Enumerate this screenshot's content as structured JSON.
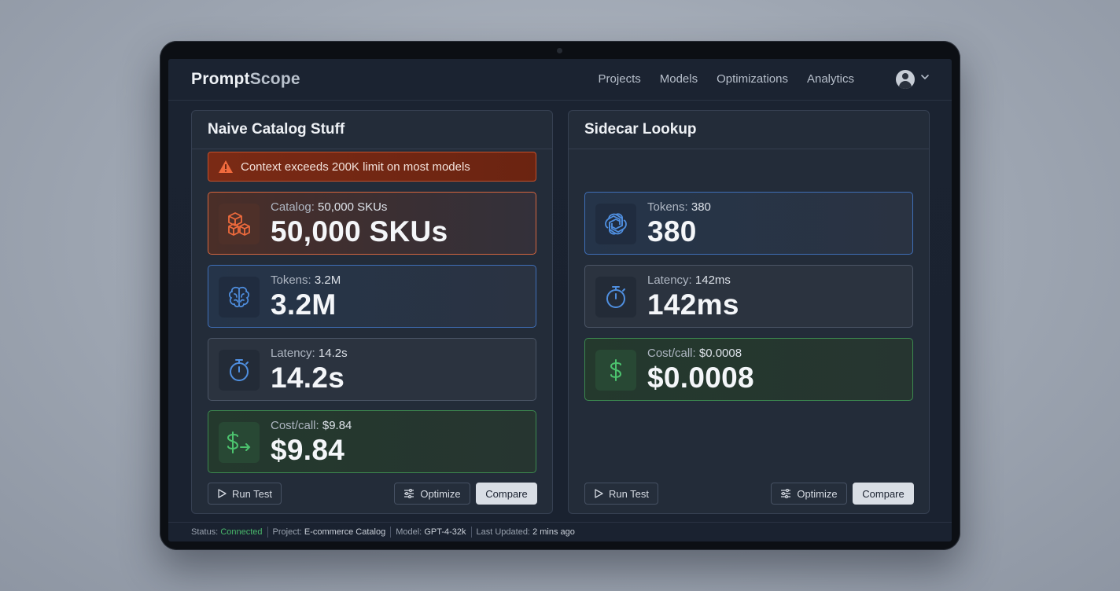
{
  "app": {
    "logo_part1": "Prompt",
    "logo_part2": "Scope"
  },
  "nav": {
    "items": [
      "Projects",
      "Models",
      "Optimizations",
      "Analytics"
    ],
    "avatar_icon": "user-avatar-icon",
    "menu_icon": "chevron-down-icon"
  },
  "left_panel": {
    "title": "Naive Catalog Stuff",
    "alert": {
      "icon": "warning-icon",
      "text": "Context exceeds 200K limit on most models"
    },
    "cards": [
      {
        "icon": "boxes-icon",
        "label": "Catalog:",
        "label_value": "50,000 SKUs",
        "value": "50,000 SKUs"
      },
      {
        "icon": "brain-icon",
        "label": "Tokens:",
        "label_value": "3.2M",
        "value": "3.2M"
      },
      {
        "icon": "stopwatch-icon",
        "label": "Latency:",
        "label_value": "14.2s",
        "value": "14.2s"
      },
      {
        "icon": "dollar-arrow-icon",
        "label": "Cost/call:",
        "label_value": "$9.84",
        "value": "$9.84"
      }
    ],
    "buttons": {
      "run": "Run Test",
      "optimize": "Optimize",
      "compare": "Compare"
    }
  },
  "right_panel": {
    "title": "Sidecar Lookup",
    "cards": [
      {
        "icon": "openai-icon",
        "label": "Tokens:",
        "label_value": "380",
        "value": "380"
      },
      {
        "icon": "stopwatch-icon",
        "label": "Latency:",
        "label_value": "142ms",
        "value": "142ms"
      },
      {
        "icon": "dollar-icon",
        "label": "Cost/call:",
        "label_value": "$0.0008",
        "value": "$0.0008"
      }
    ],
    "buttons": {
      "run": "Run Test",
      "optimize": "Optimize",
      "compare": "Compare"
    }
  },
  "status_bar": {
    "status_label": "Status:",
    "status_value": "Connected",
    "project_label": "Project:",
    "project_value": "E-commerce Catalog",
    "model_label": "Model:",
    "model_value": "GPT-4-32k",
    "updated_label": "Last Updated:",
    "updated_value": "2 mins ago"
  },
  "colors": {
    "accent_orange": "#d6663f",
    "accent_blue": "#3f6fb8",
    "accent_green": "#3c8a4f",
    "status_ok": "#49b86b"
  }
}
